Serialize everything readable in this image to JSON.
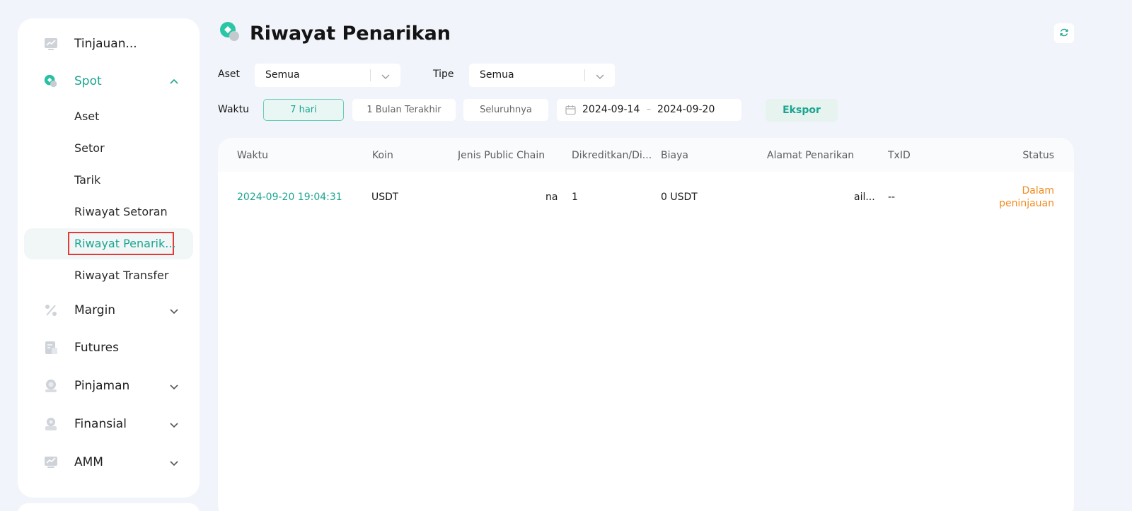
{
  "sidebar": {
    "items": [
      {
        "label": "Tinjauan..."
      },
      {
        "label": "Spot"
      },
      {
        "label": "Margin"
      },
      {
        "label": "Futures"
      },
      {
        "label": "Pinjaman"
      },
      {
        "label": "Finansial"
      },
      {
        "label": "AMM"
      }
    ],
    "spot_sub": [
      {
        "label": "Aset"
      },
      {
        "label": "Setor"
      },
      {
        "label": "Tarik"
      },
      {
        "label": "Riwayat Setoran"
      },
      {
        "label": "Riwayat Penarik..."
      },
      {
        "label": "Riwayat Transfer"
      }
    ]
  },
  "header": {
    "title": "Riwayat Penarikan"
  },
  "filters": {
    "asset_label": "Aset",
    "asset_value": "Semua",
    "type_label": "Tipe",
    "type_value": "Semua",
    "time_label": "Waktu",
    "chips": [
      "7 hari",
      "1 Bulan Terakhir",
      "Seluruhnya"
    ],
    "date_start": "2024-09-14",
    "date_sep": "–",
    "date_end": "2024-09-20",
    "export_label": "Ekspor"
  },
  "table": {
    "headers": [
      "Waktu",
      "Koin",
      "Jenis Public Chain",
      "Dikreditkan/Di...",
      "Biaya",
      "Alamat Penarikan",
      "TxID",
      "Status"
    ],
    "rows": [
      {
        "time": "2024-09-20 19:04:31",
        "coin": "USDT",
        "chain": "na",
        "credited": "1",
        "fee": "0 USDT",
        "address": "ail...",
        "txid": "--",
        "status": "Dalam peninjauan"
      }
    ]
  },
  "colors": {
    "accent": "#1ba590",
    "status_pending": "#f08c1e",
    "highlight": "#e53935"
  }
}
